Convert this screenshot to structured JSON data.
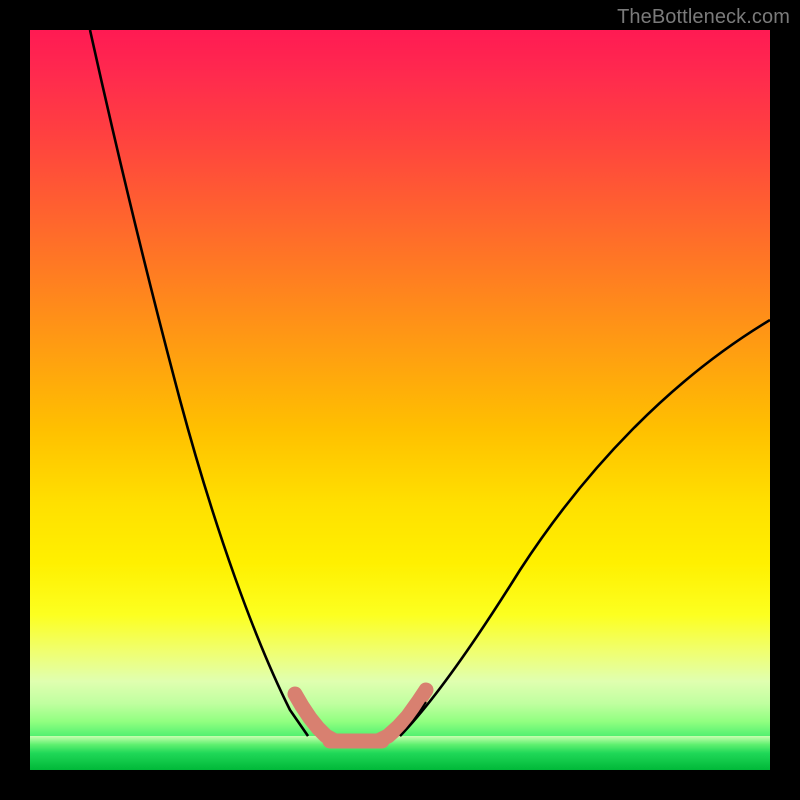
{
  "watermark": "TheBottleneck.com",
  "chart_data": {
    "type": "line",
    "title": "",
    "xlabel": "",
    "ylabel": "",
    "xlim": [
      0,
      100
    ],
    "ylim": [
      0,
      100
    ],
    "background_gradient": {
      "top": "#ff1a53",
      "mid_upper": "#ff8020",
      "mid": "#ffe000",
      "lower": "#90ff80",
      "bottom": "#00c040"
    },
    "series": [
      {
        "name": "bottleneck-curve",
        "color": "#000000",
        "x": [
          8,
          12,
          16,
          20,
          24,
          28,
          32,
          36,
          38,
          40,
          42,
          45,
          48,
          50,
          55,
          60,
          65,
          70,
          75,
          80,
          85,
          90,
          95,
          100
        ],
        "y": [
          100,
          90,
          78,
          66,
          54,
          42,
          30,
          18,
          12,
          7,
          4,
          2,
          2,
          3,
          6,
          12,
          18,
          24,
          30,
          36,
          42,
          48,
          54,
          60
        ]
      },
      {
        "name": "highlight-segment",
        "color": "#d88070",
        "x": [
          38,
          40,
          42,
          44,
          46,
          48,
          50,
          52
        ],
        "y": [
          12,
          7,
          4,
          2,
          2,
          2,
          3,
          6
        ]
      }
    ],
    "annotations": []
  }
}
